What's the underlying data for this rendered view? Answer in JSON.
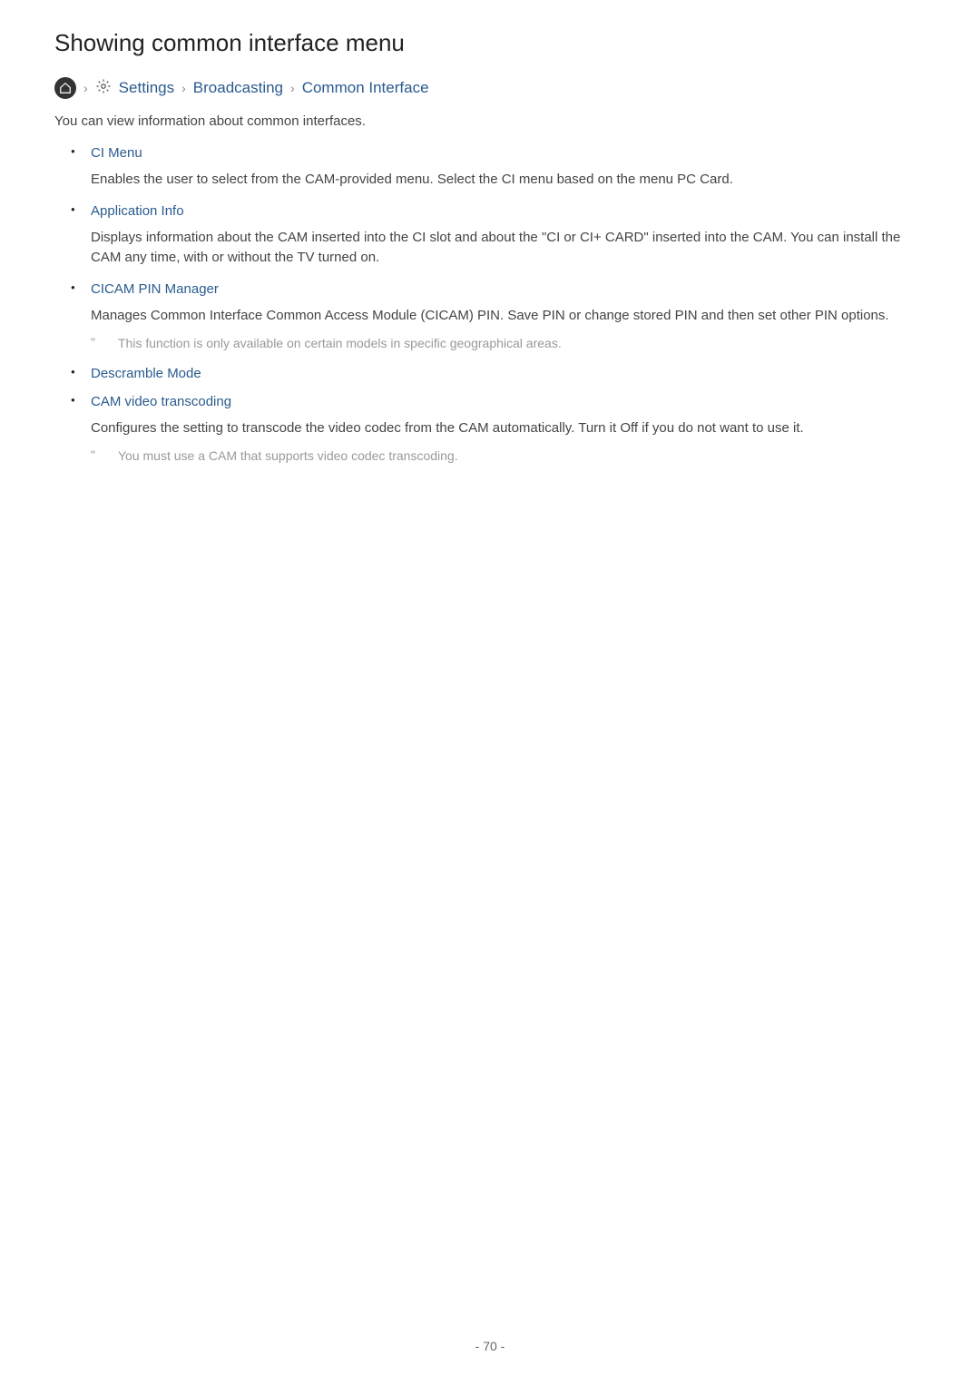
{
  "title": "Showing common interface menu",
  "breadcrumb": {
    "settings": "Settings",
    "broadcasting": "Broadcasting",
    "common_interface": "Common Interface"
  },
  "intro": "You can view information about common interfaces.",
  "items": [
    {
      "title": "CI Menu",
      "desc": "Enables the user to select from the CAM-provided menu. Select the CI menu based on the menu PC Card.",
      "note": null
    },
    {
      "title": "Application Info",
      "desc": "Displays information about the CAM inserted into the CI slot and about the \"CI or CI+ CARD\" inserted into the CAM. You can install the CAM any time, with or without the TV turned on.",
      "note": null
    },
    {
      "title": "CICAM PIN Manager",
      "desc": "Manages Common Interface Common Access Module (CICAM) PIN. Save PIN or change stored PIN and then set other PIN options.",
      "note": "This function is only available on certain models in specific geographical areas."
    },
    {
      "title": "Descramble Mode",
      "desc": null,
      "note": null
    },
    {
      "title": "CAM video transcoding",
      "desc": "Configures the setting to transcode the video codec from the CAM automatically. Turn it Off if you do not want to use it.",
      "note": "You must use a CAM that supports video codec transcoding."
    }
  ],
  "note_marker": "\"",
  "page_number": "- 70 -"
}
